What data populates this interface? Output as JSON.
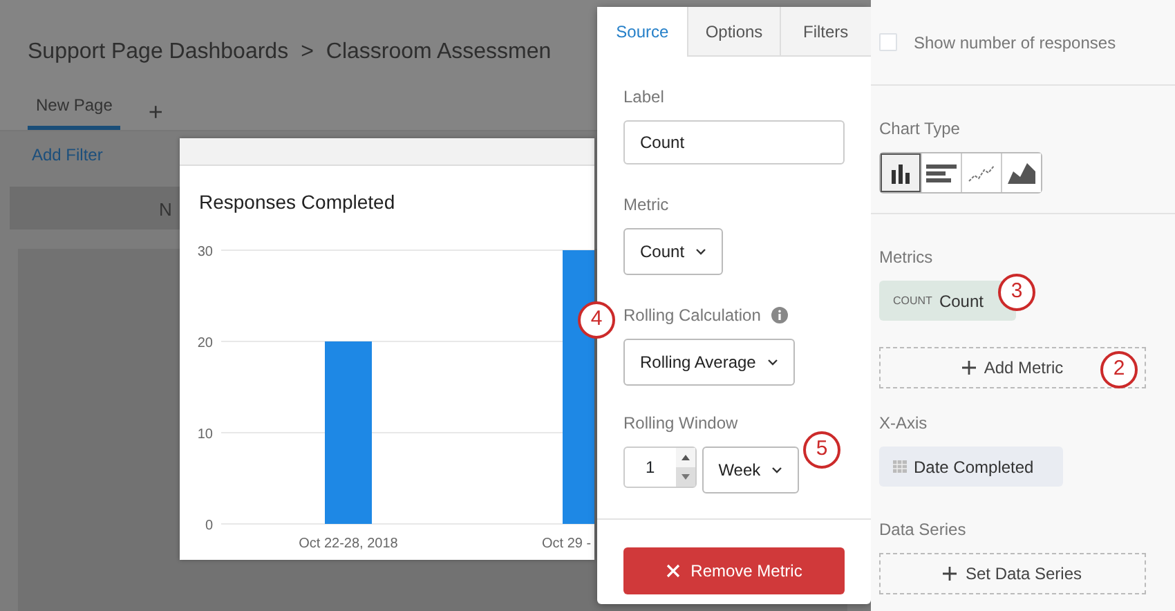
{
  "header": {
    "breadcrumb": [
      "Support Page Dashboards",
      "Classroom Assessmen"
    ],
    "separator": ">"
  },
  "page_tabs": [
    {
      "label": "New Page",
      "selected": true
    }
  ],
  "add_page": "+",
  "add_filter": "Add Filter",
  "background_widget": {
    "text": "N"
  },
  "widget": {
    "title": "Responses Completed",
    "chart_data": {
      "type": "bar",
      "categories": [
        "Oct 22-28, 2018",
        "Oct 29 -"
      ],
      "series": [
        {
          "color": "#1e88e5",
          "values": [
            20,
            30
          ]
        }
      ],
      "ylim": [
        0,
        30
      ],
      "yticks": [
        0,
        10,
        20,
        30
      ]
    }
  },
  "popover": {
    "tabs": [
      {
        "label": "Source",
        "selected": true
      },
      {
        "label": "Options",
        "selected": false
      },
      {
        "label": "Filters",
        "selected": false
      }
    ],
    "label_field": {
      "label": "Label",
      "value": "Count"
    },
    "metric": {
      "label": "Metric",
      "value": "Count"
    },
    "rolling_calculation": {
      "label": "Rolling Calculation",
      "value": "Rolling Average"
    },
    "rolling_window": {
      "label": "Rolling Window",
      "number": "1",
      "unit": "Week"
    },
    "remove_button": "Remove Metric"
  },
  "panel": {
    "show_responses": {
      "label": "Show number of responses",
      "checked": false
    },
    "chart_type": {
      "label": "Chart Type",
      "types": [
        {
          "kind": "column",
          "selected": true
        },
        {
          "kind": "bar",
          "selected": false
        },
        {
          "kind": "line",
          "selected": false
        },
        {
          "kind": "area",
          "selected": false
        }
      ]
    },
    "metrics": {
      "label": "Metrics",
      "items": [
        {
          "tag": "COUNT",
          "name": "Count"
        }
      ],
      "add": "Add Metric"
    },
    "x_axis": {
      "label": "X-Axis",
      "value": "Date Completed"
    },
    "data_series": {
      "label": "Data Series",
      "add": "Set Data Series"
    }
  },
  "callouts": [
    {
      "number": "4"
    },
    {
      "number": "5"
    },
    {
      "number": "3"
    },
    {
      "number": "2"
    }
  ]
}
